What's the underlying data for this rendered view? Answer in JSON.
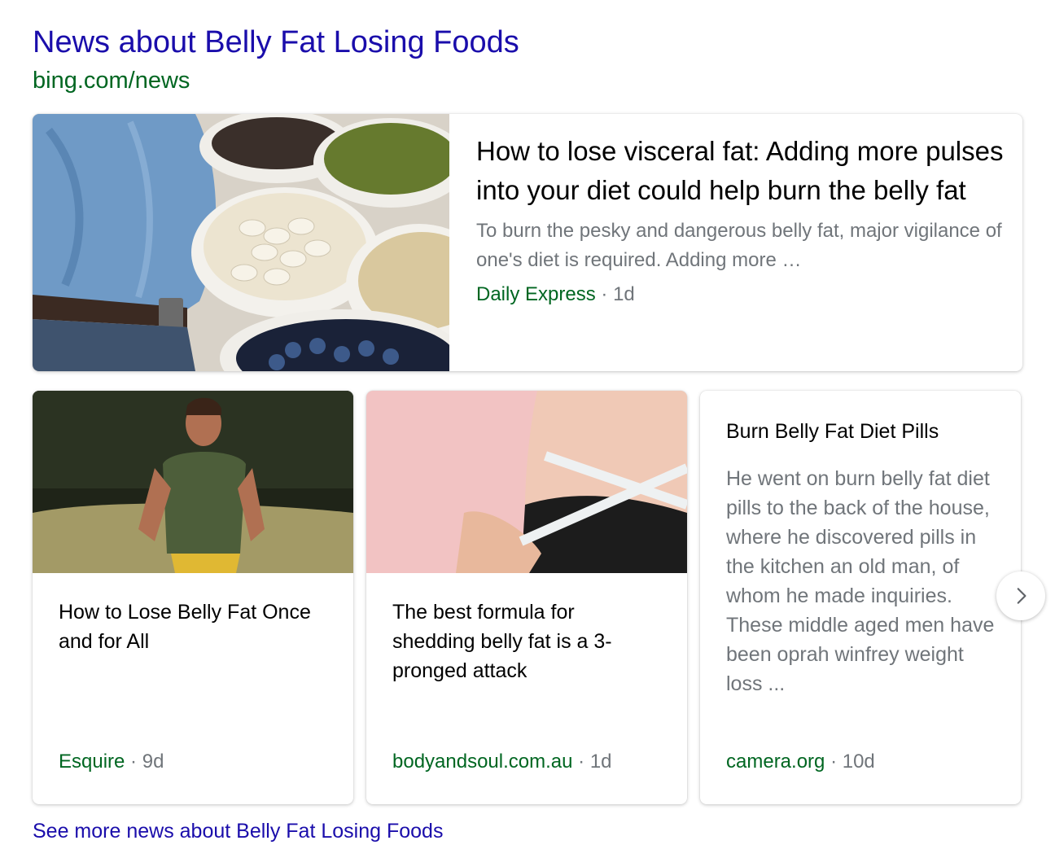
{
  "header": {
    "title": "News about Belly Fat Losing Foods",
    "url": "bing.com/news"
  },
  "main_article": {
    "headline": "How to lose visceral fat: Adding more pulses into your diet could help burn the belly fat",
    "snippet": "To burn the pesky and dangerous belly fat, major vigilance of one's diet is required. Adding more …",
    "source": "Daily Express",
    "separator": "·",
    "age": "1d",
    "image": "belly-and-pulses-photo"
  },
  "cards": [
    {
      "headline": "How to Lose Belly Fat Once and for All",
      "source": "Esquire",
      "separator": "·",
      "age": "9d",
      "image": "man-running-photo"
    },
    {
      "headline": "The best formula for shedding belly fat is a 3-pronged attack",
      "source": "bodyandsoul.com.au",
      "separator": "·",
      "age": "1d",
      "image": "waist-measuring-tape-photo"
    },
    {
      "headline": "Burn Belly Fat Diet Pills",
      "snippet": "He went on burn belly fat diet pills to the back of the house, where he discovered pills in the kitchen an old man, of whom he made inquiries. These middle aged men have been oprah winfrey weight loss ...",
      "source": "camera.org",
      "separator": "·",
      "age": "10d"
    }
  ],
  "next_button_icon": "chevron-right-icon",
  "see_more": "See more news about Belly Fat Losing Foods",
  "colors": {
    "link": "#1a0dab",
    "source": "#006621",
    "muted": "#70757a"
  }
}
